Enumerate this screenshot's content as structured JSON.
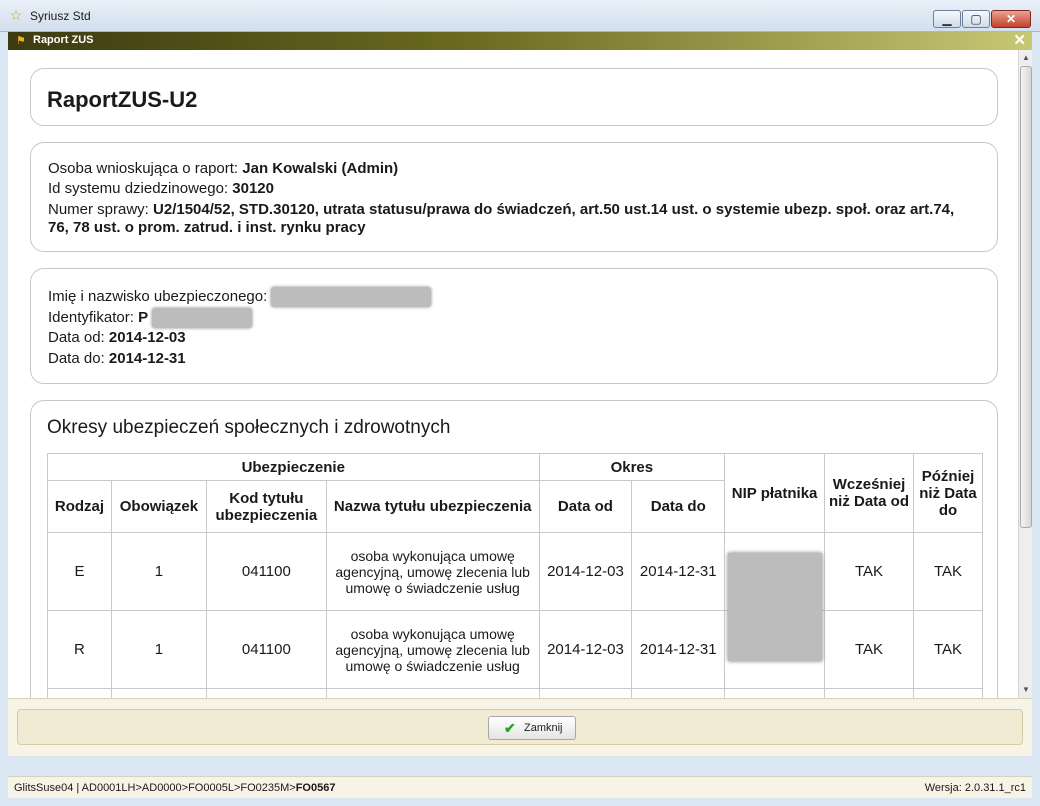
{
  "window": {
    "title": "Syriusz Std"
  },
  "app": {
    "header_title": "Raport ZUS"
  },
  "report": {
    "title": "RaportZUS-U2"
  },
  "requester": {
    "person_label": "Osoba wnioskująca o raport:",
    "person_value": "Jan Kowalski (Admin)",
    "system_id_label": "Id systemu dziedzinowego:",
    "system_id_value": "30120",
    "case_label": "Numer sprawy:",
    "case_value": "U2/1504/52, STD.30120, utrata statusu/prawa do świadczeń, art.50 ust.14 ust. o systemie ubezp. społ. oraz art.74, 76, 78 ust. o prom. zatrud. i inst. rynku pracy"
  },
  "insured": {
    "name_label": "Imię i nazwisko ubezpieczonego:",
    "id_label": "Identyfikator:",
    "id_prefix": "P",
    "date_from_label": "Data od:",
    "date_from_value": "2014-12-03",
    "date_to_label": "Data do:",
    "date_to_value": "2014-12-31"
  },
  "periods": {
    "title": "Okresy ubezpieczeń społecznych i zdrowotnych",
    "headers": {
      "insurance": "Ubezpieczenie",
      "period": "Okres",
      "nip": "NIP płatnika",
      "earlier": "Wcześniej niż Data od",
      "later": "Później niż Data do",
      "type": "Rodzaj",
      "obligation": "Obowiązek",
      "code": "Kod tytułu ubezpieczenia",
      "name": "Nazwa tytułu ubezpieczenia",
      "date_from": "Data od",
      "date_to": "Data do"
    },
    "rows": [
      {
        "type": "E",
        "obligation": "1",
        "code": "041100",
        "name": "osoba wykonująca umowę agencyjną, umowę zlecenia lub umowę o świadczenie usług",
        "date_from": "2014-12-03",
        "date_to": "2014-12-31",
        "earlier": "TAK",
        "later": "TAK"
      },
      {
        "type": "R",
        "obligation": "1",
        "code": "041100",
        "name": "osoba wykonująca umowę agencyjną, umowę zlecenia lub umowę o świadczenie usług",
        "date_from": "2014-12-03",
        "date_to": "2014-12-31",
        "earlier": "TAK",
        "later": "TAK"
      }
    ]
  },
  "buttons": {
    "close_label": "Zamknij"
  },
  "status": {
    "path": "GlitsSuse04 | AD0001LH>AD0000>FO0005L>FO0235M>",
    "path_current": "FO0567",
    "version": "Wersja: 2.0.31.1_rc1"
  }
}
